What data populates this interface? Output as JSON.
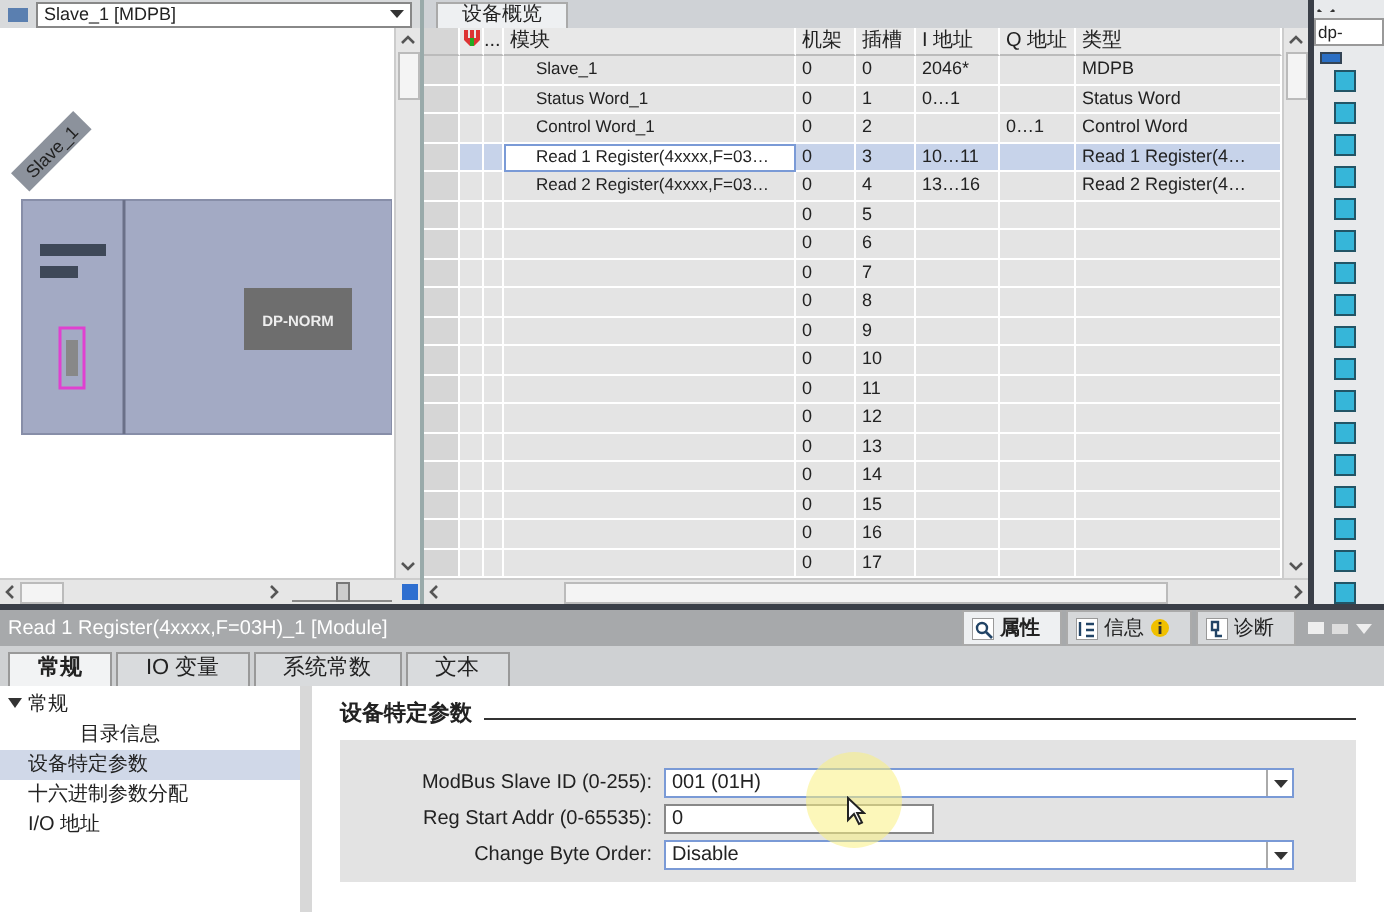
{
  "device_view": {
    "device_selector": "Slave_1 [MDPB]",
    "device": {
      "name": "Slave_1",
      "module_label": "DP-NORM"
    },
    "zoom": {
      "level": 0.5
    }
  },
  "device_overview": {
    "tab": "设备概览",
    "columns": {
      "dots": "...",
      "module": "模块",
      "rack": "机架",
      "slot": "插槽",
      "i_address": "I 地址",
      "q_address": "Q 地址",
      "type": "类型"
    },
    "rows": [
      {
        "module": "Slave_1",
        "rack": "0",
        "slot": "0",
        "i_address": "2046*",
        "q_address": "",
        "type": "MDPB",
        "selected": false
      },
      {
        "module": "Status Word_1",
        "rack": "0",
        "slot": "1",
        "i_address": "0…1",
        "q_address": "",
        "type": "Status Word",
        "selected": false
      },
      {
        "module": "Control Word_1",
        "rack": "0",
        "slot": "2",
        "i_address": "",
        "q_address": "0…1",
        "type": "Control Word",
        "selected": false
      },
      {
        "module": "Read 1 Register(4xxxx,F=03…",
        "rack": "0",
        "slot": "3",
        "i_address": "10…11",
        "q_address": "",
        "type": "Read 1 Register(4…",
        "selected": true
      },
      {
        "module": "Read 2 Register(4xxxx,F=03…",
        "rack": "0",
        "slot": "4",
        "i_address": "13…16",
        "q_address": "",
        "type": "Read 2 Register(4…",
        "selected": false
      },
      {
        "module": "",
        "rack": "0",
        "slot": "5",
        "i_address": "",
        "q_address": "",
        "type": "",
        "selected": false
      },
      {
        "module": "",
        "rack": "0",
        "slot": "6",
        "i_address": "",
        "q_address": "",
        "type": "",
        "selected": false
      },
      {
        "module": "",
        "rack": "0",
        "slot": "7",
        "i_address": "",
        "q_address": "",
        "type": "",
        "selected": false
      },
      {
        "module": "",
        "rack": "0",
        "slot": "8",
        "i_address": "",
        "q_address": "",
        "type": "",
        "selected": false
      },
      {
        "module": "",
        "rack": "0",
        "slot": "9",
        "i_address": "",
        "q_address": "",
        "type": "",
        "selected": false
      },
      {
        "module": "",
        "rack": "0",
        "slot": "10",
        "i_address": "",
        "q_address": "",
        "type": "",
        "selected": false
      },
      {
        "module": "",
        "rack": "0",
        "slot": "11",
        "i_address": "",
        "q_address": "",
        "type": "",
        "selected": false
      },
      {
        "module": "",
        "rack": "0",
        "slot": "12",
        "i_address": "",
        "q_address": "",
        "type": "",
        "selected": false
      },
      {
        "module": "",
        "rack": "0",
        "slot": "13",
        "i_address": "",
        "q_address": "",
        "type": "",
        "selected": false
      },
      {
        "module": "",
        "rack": "0",
        "slot": "14",
        "i_address": "",
        "q_address": "",
        "type": "",
        "selected": false
      },
      {
        "module": "",
        "rack": "0",
        "slot": "15",
        "i_address": "",
        "q_address": "",
        "type": "",
        "selected": false
      },
      {
        "module": "",
        "rack": "0",
        "slot": "16",
        "i_address": "",
        "q_address": "",
        "type": "",
        "selected": false
      },
      {
        "module": "",
        "rack": "0",
        "slot": "17",
        "i_address": "",
        "q_address": "",
        "type": "",
        "selected": false
      }
    ]
  },
  "catalog_panel": {
    "search": {
      "value": "dp-"
    },
    "filter_checked": true
  },
  "inspector": {
    "title": "Read 1 Register(4xxxx,F=03H)_1 [Module]",
    "view_tabs": [
      {
        "label": "属性",
        "kind": "properties",
        "selected": true
      },
      {
        "label": "信息",
        "kind": "info",
        "selected": false
      },
      {
        "label": "诊断",
        "kind": "diagnostics",
        "selected": false
      }
    ],
    "tabs": [
      {
        "label": "常规",
        "selected": true
      },
      {
        "label": "IO 变量",
        "selected": false
      },
      {
        "label": "系统常数",
        "selected": false
      },
      {
        "label": "文本",
        "selected": false
      }
    ],
    "nav": [
      {
        "label": "常规",
        "selected": false,
        "expanded": true,
        "children": [
          {
            "label": "目录信息",
            "selected": false
          }
        ]
      },
      {
        "label": "设备特定参数",
        "selected": true
      },
      {
        "label": "十六进制参数分配",
        "selected": false
      },
      {
        "label": "I/O 地址",
        "selected": false
      }
    ],
    "section_title": "设备特定参数",
    "params": [
      {
        "kind": "dropdown",
        "label": "ModBus Slave ID (0-255):",
        "value": "001 (01H)"
      },
      {
        "kind": "input",
        "label": "Reg Start Addr (0-65535):",
        "value": "0"
      },
      {
        "kind": "dropdown",
        "label": "Change Byte Order:",
        "value": "Disable"
      }
    ]
  }
}
